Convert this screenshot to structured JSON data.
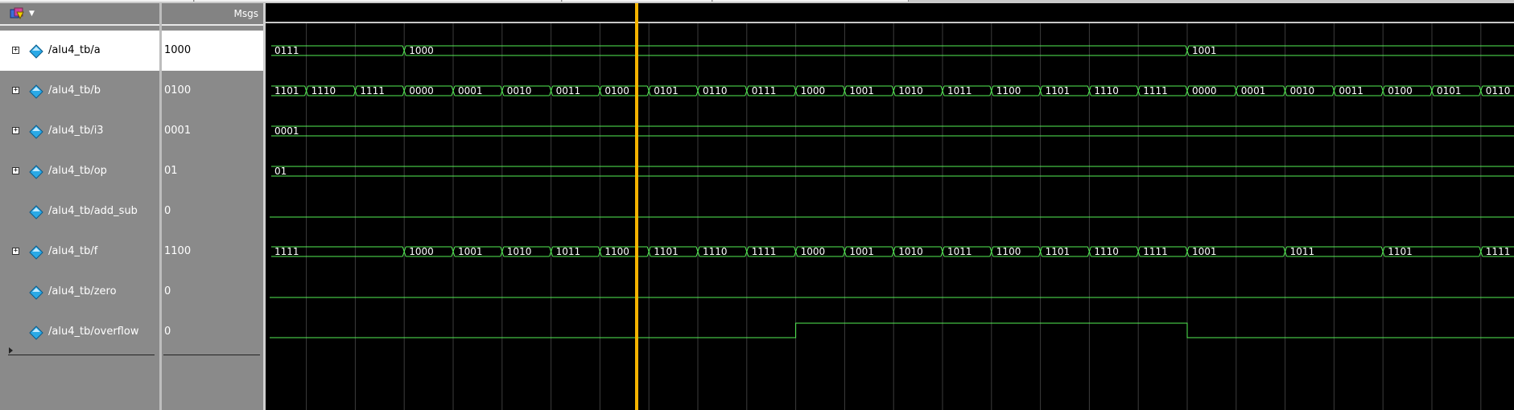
{
  "header": {
    "values_label": "Msgs",
    "app_icon": "modelsim-wave-icon",
    "menu_caret": "chevron-down-icon"
  },
  "colors": {
    "wave": "#55ee55",
    "cursor": "#f5b400",
    "grid": "#3c3c3c",
    "signal_icon": "#2aa9e6",
    "label_text": "#ffffff"
  },
  "signals": [
    {
      "name": "/alu4_tb/a",
      "value": "1000",
      "expandable": true,
      "selected": true,
      "kind": "bus",
      "segments": [
        [
          "0111",
          0
        ],
        [
          "1000",
          2.75
        ],
        [
          "1001",
          18.75
        ]
      ]
    },
    {
      "name": "/alu4_tb/b",
      "value": "0100",
      "expandable": true,
      "selected": false,
      "kind": "bus",
      "segments": [
        [
          "1101",
          0
        ],
        [
          "1110",
          0.75
        ],
        [
          "1111",
          1.75
        ],
        [
          "0000",
          2.75
        ],
        [
          "0001",
          3.75
        ],
        [
          "0010",
          4.75
        ],
        [
          "0011",
          5.75
        ],
        [
          "0100",
          6.75
        ],
        [
          "0101",
          7.75
        ],
        [
          "0110",
          8.75
        ],
        [
          "0111",
          9.75
        ],
        [
          "1000",
          10.75
        ],
        [
          "1001",
          11.75
        ],
        [
          "1010",
          12.75
        ],
        [
          "1011",
          13.75
        ],
        [
          "1100",
          14.75
        ],
        [
          "1101",
          15.75
        ],
        [
          "1110",
          16.75
        ],
        [
          "1111",
          17.75
        ],
        [
          "0000",
          18.75
        ],
        [
          "0001",
          19.75
        ],
        [
          "0010",
          20.75
        ],
        [
          "0011",
          21.75
        ],
        [
          "0100",
          22.75
        ],
        [
          "0101",
          23.75
        ],
        [
          "0110",
          24.75
        ]
      ]
    },
    {
      "name": "/alu4_tb/i3",
      "value": "0001",
      "expandable": true,
      "selected": false,
      "kind": "bus",
      "segments": [
        [
          "0001",
          0
        ]
      ]
    },
    {
      "name": "/alu4_tb/op",
      "value": "01",
      "expandable": true,
      "selected": false,
      "kind": "bus",
      "segments": [
        [
          "01",
          0
        ]
      ]
    },
    {
      "name": "/alu4_tb/add_sub",
      "value": "0",
      "expandable": false,
      "selected": false,
      "kind": "bit",
      "levels": [
        [
          0,
          0
        ]
      ]
    },
    {
      "name": "/alu4_tb/f",
      "value": "1100",
      "expandable": true,
      "selected": false,
      "kind": "bus",
      "segments": [
        [
          "1111",
          0
        ],
        [
          "1000",
          2.75
        ],
        [
          "1001",
          3.75
        ],
        [
          "1010",
          4.75
        ],
        [
          "1011",
          5.75
        ],
        [
          "1100",
          6.75
        ],
        [
          "1101",
          7.75
        ],
        [
          "1110",
          8.75
        ],
        [
          "1111",
          9.75
        ],
        [
          "1000",
          10.75
        ],
        [
          "1001",
          11.75
        ],
        [
          "1010",
          12.75
        ],
        [
          "1011",
          13.75
        ],
        [
          "1100",
          14.75
        ],
        [
          "1101",
          15.75
        ],
        [
          "1110",
          16.75
        ],
        [
          "1111",
          17.75
        ],
        [
          "1001",
          18.75
        ],
        [
          "1011",
          20.75
        ],
        [
          "1101",
          22.75
        ],
        [
          "1111",
          24.75
        ]
      ]
    },
    {
      "name": "/alu4_tb/zero",
      "value": "0",
      "expandable": false,
      "selected": false,
      "kind": "bit",
      "levels": [
        [
          0,
          0
        ]
      ]
    },
    {
      "name": "/alu4_tb/overflow",
      "value": "0",
      "expandable": false,
      "selected": false,
      "kind": "bit",
      "levels": [
        [
          0,
          0
        ],
        [
          1,
          10.75
        ],
        [
          0,
          18.75
        ]
      ]
    }
  ],
  "timeline": {
    "cursor_time": 7.5
  }
}
